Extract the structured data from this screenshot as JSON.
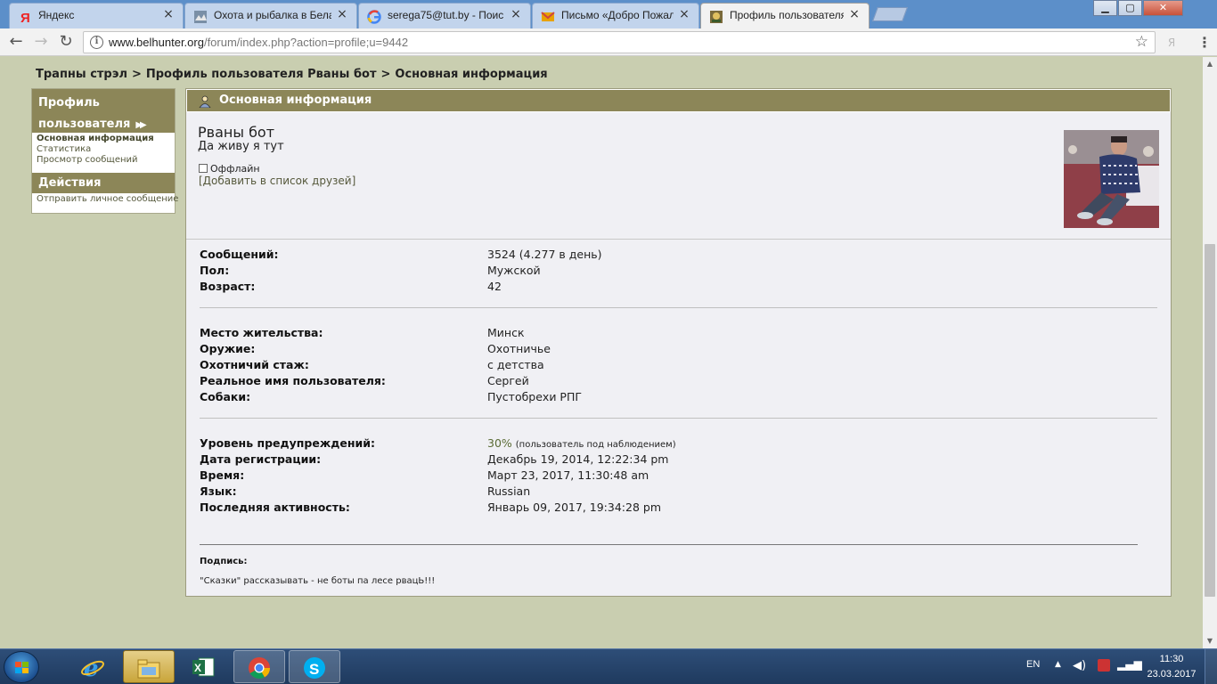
{
  "browser": {
    "tabs": [
      {
        "title": "Яндекс",
        "icon": "yandex-icon"
      },
      {
        "title": "Охота и рыбалка в Бела",
        "icon": "hunting-site-icon"
      },
      {
        "title": "serega75@tut.by - Поис",
        "icon": "google-icon"
      },
      {
        "title": "Письмо «Добро Пожало",
        "icon": "mail-icon"
      },
      {
        "title": "Профиль пользователя",
        "icon": "forum-icon",
        "active": true
      }
    ],
    "url_host": "www.belhunter.org",
    "url_path": "/forum/index.php?action=profile;u=9442",
    "window_buttons": {
      "minimize": "▁",
      "maximize": "▢",
      "close": "✕"
    }
  },
  "breadcrumb": {
    "items": [
      "Трапны стрэл",
      "Профиль пользователя Рваны бот",
      "Основная информация"
    ],
    "separator": ">"
  },
  "sidebar": {
    "profile_heading_line1": "Профиль",
    "profile_heading_line2": "пользователя",
    "profile_links": [
      "Основная информация",
      "Статистика",
      "Просмотр сообщений"
    ],
    "actions_heading": "Действия",
    "action_links": [
      "Отправить личное сообщение"
    ]
  },
  "profile": {
    "header_title": "Основная информация",
    "username": "Рваны бот",
    "user_title": "Да живу я тут",
    "online_status": "Оффлайн",
    "add_friend": "[Добавить в список друзей]",
    "group1": [
      {
        "label": "Сообщений:",
        "value": "3524 (4.277 в день)"
      },
      {
        "label": "Пол:",
        "value": "Мужской"
      },
      {
        "label": "Возраст:",
        "value": "42"
      }
    ],
    "group2": [
      {
        "label": "Место жительства:",
        "value": "Минск"
      },
      {
        "label": "Оружие:",
        "value": "Охотничье"
      },
      {
        "label": "Охотничий стаж:",
        "value": "с детства"
      },
      {
        "label": "Реальное имя пользователя:",
        "value": "Сергей"
      },
      {
        "label": "Собаки:",
        "value": "Пустобрехи РПГ"
      }
    ],
    "warning_label": "Уровень предупреждений:",
    "warning_percent": "30%",
    "warning_note": "(пользователь под наблюдением)",
    "group3": [
      {
        "label": "Дата регистрации:",
        "value": "Декабрь 19, 2014, 12:22:34 pm"
      },
      {
        "label": "Время:",
        "value": "Март 23, 2017, 11:30:48 am"
      },
      {
        "label": "Язык:",
        "value": "Russian"
      },
      {
        "label": "Последняя активность:",
        "value": "Январь 09, 2017, 19:34:28 pm"
      }
    ],
    "signature_label": "Подпись:",
    "signature_text": "\"Сказки\" рассказывать - не боты па лесе рвацЬ!!!"
  },
  "taskbar": {
    "language": "EN",
    "time": "11:30",
    "date": "23.03.2017",
    "apps": [
      "internet-explorer-icon",
      "file-explorer-icon",
      "excel-icon",
      "chrome-icon",
      "skype-icon"
    ]
  },
  "colors": {
    "header_olive": "#8c8658",
    "page_bg": "#c9ceb0",
    "panel_bg": "#f0f0f4",
    "link_olive": "#55583b"
  }
}
